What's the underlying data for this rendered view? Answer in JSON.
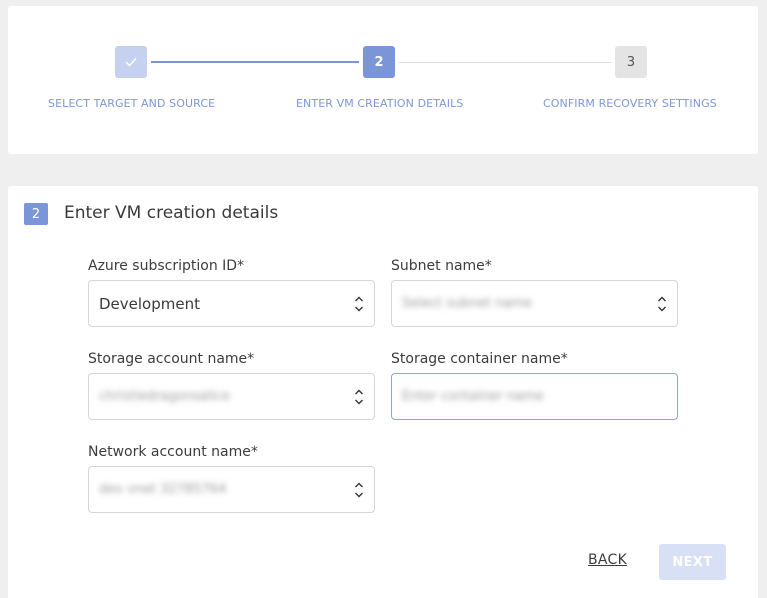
{
  "stepper": {
    "steps": [
      {
        "number": "✓",
        "label": "SELECT TARGET AND SOURCE",
        "state": "completed"
      },
      {
        "number": "2",
        "label": "ENTER VM CREATION DETAILS",
        "state": "active"
      },
      {
        "number": "3",
        "label": "CONFIRM RECOVERY SETTINGS",
        "state": "pending"
      }
    ]
  },
  "section": {
    "number": "2",
    "title": "Enter VM creation details"
  },
  "form": {
    "azure_subscription": {
      "label": "Azure subscription ID*",
      "value": "Development"
    },
    "subnet": {
      "label": "Subnet name*",
      "value": "Select subnet name"
    },
    "storage_account": {
      "label": "Storage account name*",
      "value": "christiedragonsalice"
    },
    "storage_container": {
      "label": "Storage container name*",
      "placeholder": "Enter container name"
    },
    "network_account": {
      "label": "Network account name*",
      "value": "dev vnet 32785764"
    }
  },
  "actions": {
    "back_label": "BACK",
    "next_label": "NEXT"
  },
  "colors": {
    "accent": "#7b95d9",
    "step_label": "#7e96d6",
    "next_disabled": "#d7e0f5"
  }
}
